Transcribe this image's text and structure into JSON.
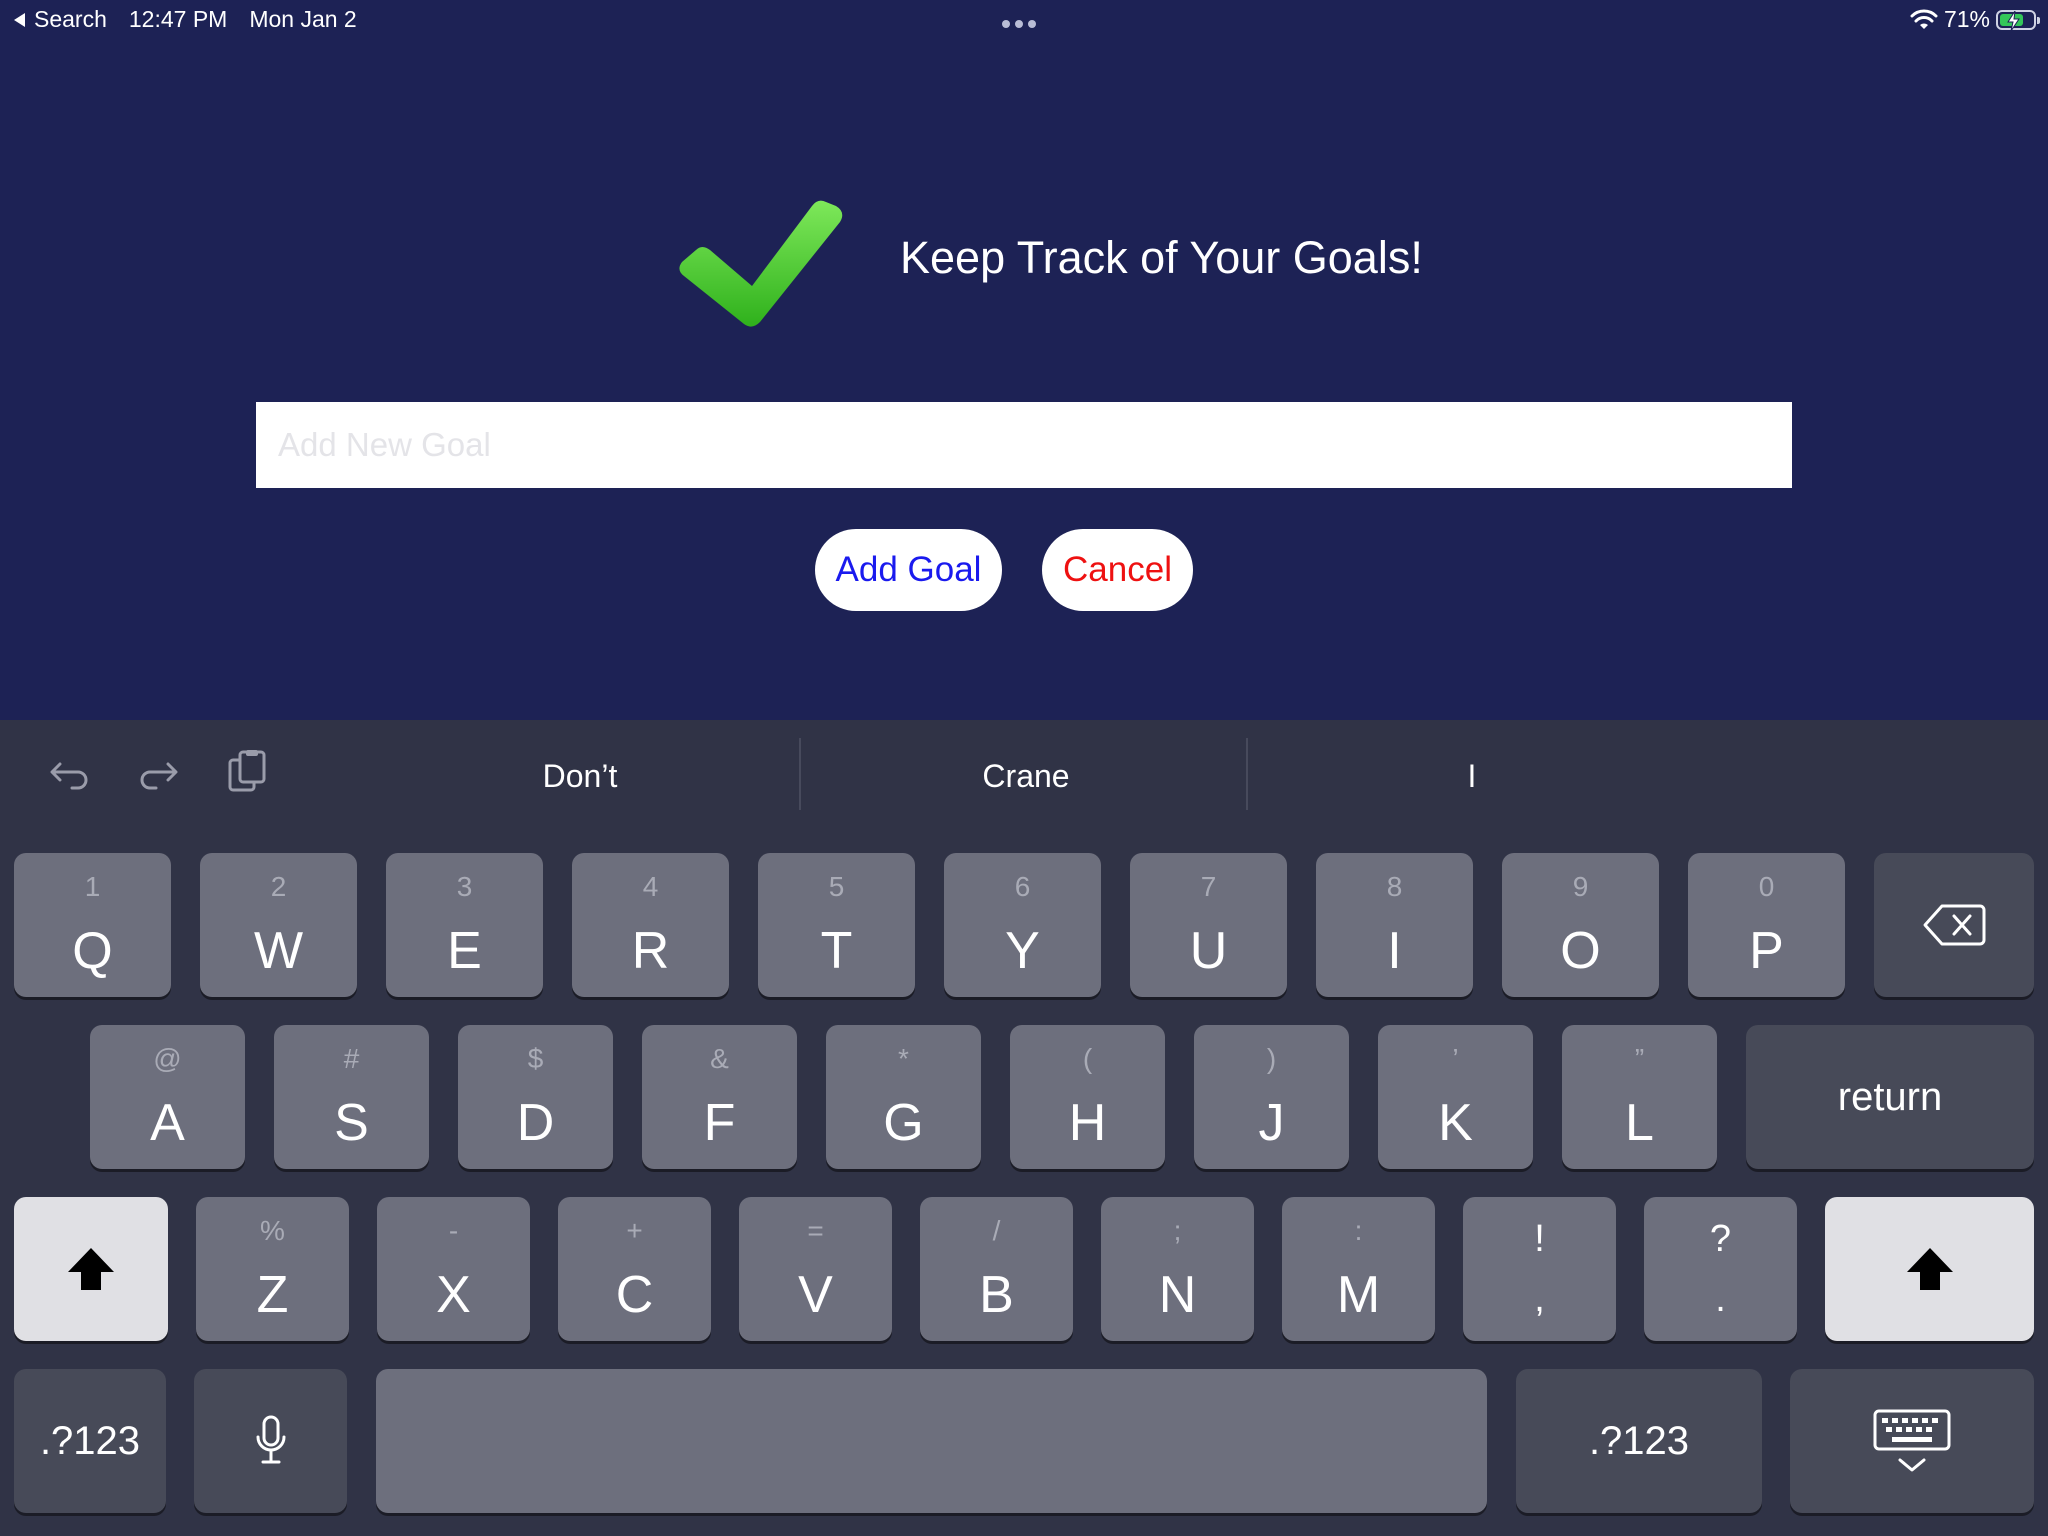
{
  "status_bar": {
    "back_label": "Search",
    "time": "12:47 PM",
    "date": "Mon Jan 2",
    "battery_percent": "71%",
    "battery_level": 0.71
  },
  "header": {
    "title": "Keep Track of Your Goals!"
  },
  "goal_input": {
    "placeholder": "Add New Goal",
    "value": ""
  },
  "buttons": {
    "add_goal": "Add Goal",
    "cancel": "Cancel"
  },
  "keyboard": {
    "suggestions": [
      "Don’t",
      "Crane",
      "I"
    ],
    "row1": [
      {
        "alt": "1",
        "main": "Q"
      },
      {
        "alt": "2",
        "main": "W"
      },
      {
        "alt": "3",
        "main": "E"
      },
      {
        "alt": "4",
        "main": "R"
      },
      {
        "alt": "5",
        "main": "T"
      },
      {
        "alt": "6",
        "main": "Y"
      },
      {
        "alt": "7",
        "main": "U"
      },
      {
        "alt": "8",
        "main": "I"
      },
      {
        "alt": "9",
        "main": "O"
      },
      {
        "alt": "0",
        "main": "P"
      }
    ],
    "row2": [
      {
        "alt": "@",
        "main": "A"
      },
      {
        "alt": "#",
        "main": "S"
      },
      {
        "alt": "$",
        "main": "D"
      },
      {
        "alt": "&",
        "main": "F"
      },
      {
        "alt": "*",
        "main": "G"
      },
      {
        "alt": "(",
        "main": "H"
      },
      {
        "alt": ")",
        "main": "J"
      },
      {
        "alt": "’",
        "main": "K"
      },
      {
        "alt": "”",
        "main": "L"
      }
    ],
    "row3": [
      {
        "alt": "%",
        "main": "Z"
      },
      {
        "alt": "-",
        "main": "X"
      },
      {
        "alt": "+",
        "main": "C"
      },
      {
        "alt": "=",
        "main": "V"
      },
      {
        "alt": "/",
        "main": "B"
      },
      {
        "alt": ";",
        "main": "N"
      },
      {
        "alt": ":",
        "main": "M"
      }
    ],
    "punct": [
      {
        "top": "!",
        "bottom": ","
      },
      {
        "top": "?",
        "bottom": "."
      }
    ],
    "return_label": "return",
    "numbers_label": ".?123"
  }
}
